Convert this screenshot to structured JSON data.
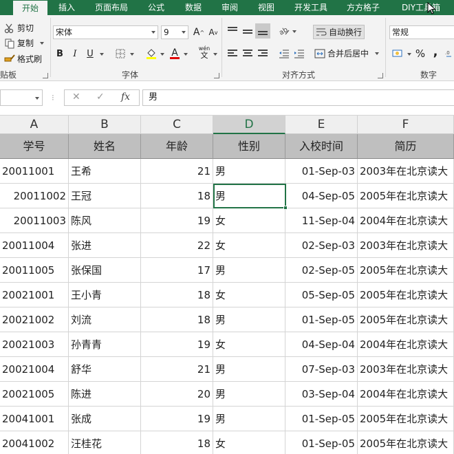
{
  "tabs": [
    "开始",
    "插入",
    "页面布局",
    "公式",
    "数据",
    "审阅",
    "视图",
    "开发工具",
    "方方格子",
    "DIY工具箱"
  ],
  "active_tab": "开始",
  "ribbon": {
    "clipboard": {
      "cut": "剪切",
      "copy": "复制",
      "format_painter": "格式刷",
      "label": "贴板"
    },
    "font": {
      "name": "宋体",
      "size": "9",
      "grow": "A",
      "shrink": "A",
      "bold": "B",
      "italic": "I",
      "underline": "U",
      "wen": "wén",
      "wen_char": "文",
      "label": "字体"
    },
    "alignment": {
      "wrap_text": "自动换行",
      "merge_center": "合并后居中",
      "label": "对齐方式"
    },
    "number": {
      "format": "常规",
      "percent": "%",
      "comma": ",",
      "label": "数字"
    }
  },
  "formula_bar": {
    "name_box": "",
    "cancel": "✕",
    "enter": "✓",
    "fx": "fx",
    "value": "男"
  },
  "columns": [
    "A",
    "B",
    "C",
    "D",
    "E",
    "F"
  ],
  "selected_column": "D",
  "table": {
    "headers": [
      "学号",
      "姓名",
      "年龄",
      "性别",
      "入校时间",
      "简历"
    ],
    "rows": [
      [
        "20011001",
        "王希",
        "21",
        "男",
        "01-Sep-03",
        "2003年在北京读大"
      ],
      [
        "20011002",
        "王冠",
        "18",
        "男",
        "04-Sep-05",
        "2005年在北京读大"
      ],
      [
        "20011003",
        "陈风",
        "19",
        "女",
        "11-Sep-04",
        "2004年在北京读大"
      ],
      [
        "20011004",
        "张进",
        "22",
        "女",
        "02-Sep-03",
        "2003年在北京读大"
      ],
      [
        "20011005",
        "张保国",
        "17",
        "男",
        "02-Sep-05",
        "2005年在北京读大"
      ],
      [
        "20021001",
        "王小青",
        "18",
        "女",
        "05-Sep-05",
        "2005年在北京读大"
      ],
      [
        "20021002",
        "刘流",
        "18",
        "男",
        "01-Sep-05",
        "2005年在北京读大"
      ],
      [
        "20021003",
        "孙青青",
        "19",
        "女",
        "04-Sep-04",
        "2004年在北京读大"
      ],
      [
        "20021004",
        "舒华",
        "21",
        "男",
        "07-Sep-03",
        "2003年在北京读大"
      ],
      [
        "20021005",
        "陈进",
        "20",
        "男",
        "03-Sep-04",
        "2004年在北京读大"
      ],
      [
        "20041001",
        "张成",
        "19",
        "男",
        "01-Sep-05",
        "2005年在北京读大"
      ],
      [
        "20041002",
        "汪桂花",
        "18",
        "女",
        "01-Sep-05",
        "2005年在北京读大"
      ]
    ]
  },
  "colors": {
    "accent": "#217346",
    "header_fill": "#bfbfbf"
  }
}
